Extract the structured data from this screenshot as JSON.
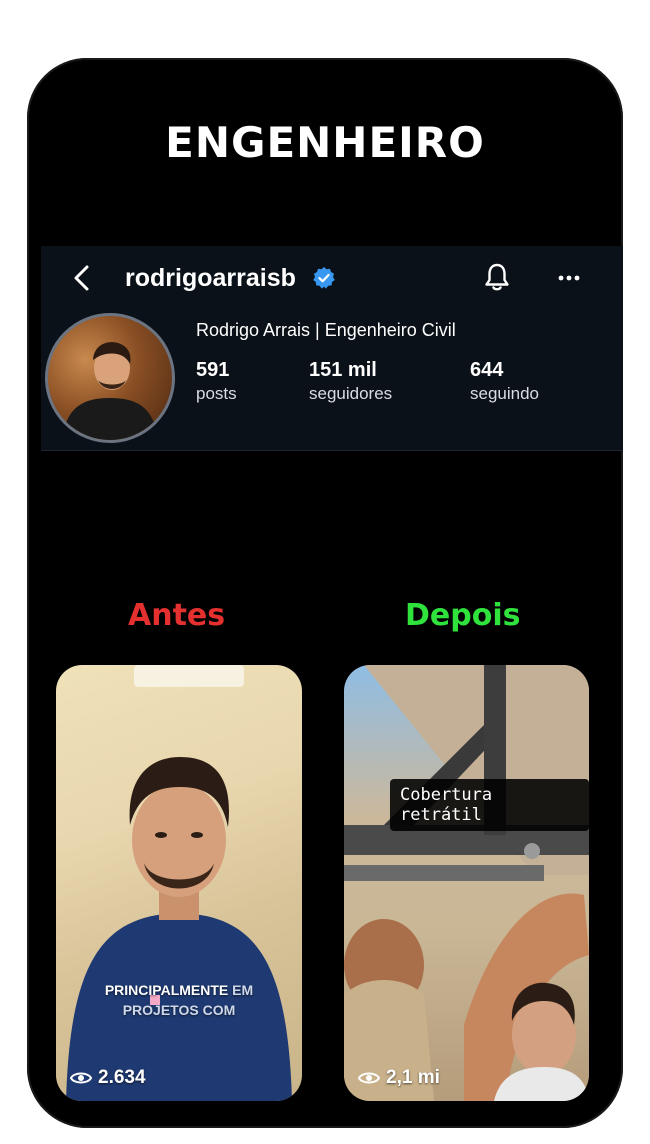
{
  "headline": "ENGENHEIRO",
  "profile": {
    "username": "rodrigoarraisb",
    "display_name": "Rodrigo Arrais | Engenheiro Civil",
    "stats": {
      "posts_count": "591",
      "posts_label": "posts",
      "followers_count": "151 mil",
      "followers_label": "seguidores",
      "following_count": "644",
      "following_label": "seguindo"
    }
  },
  "compare": {
    "before_label": "Antes",
    "after_label": "Depois"
  },
  "videos": {
    "left": {
      "caption_line1_a": "PRINCIPALMENTE",
      "caption_line1_b": "EM",
      "caption_line2": "PROJETOS COM",
      "views": "2.634"
    },
    "right": {
      "tag": "Cobertura retrátil",
      "views": "2,1 mi"
    }
  },
  "colors": {
    "before": "#e53030",
    "after": "#2fe33c",
    "verified": "#3897f0"
  }
}
